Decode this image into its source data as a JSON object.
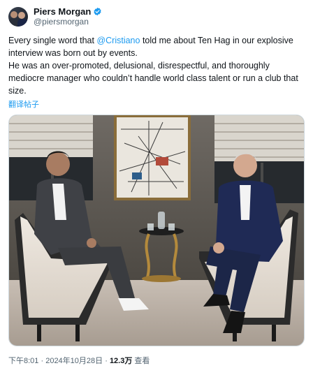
{
  "author": {
    "display_name": "Piers Morgan",
    "handle": "@piersmorgan",
    "verified_color": "#1d9bf0"
  },
  "tweet": {
    "line1_pre": "Every single word that ",
    "mention": "@Cristiano",
    "line1_post": " told me about Ten Hag in our explosive interview was born out by events.",
    "line2": "He was an over-promoted, delusional, disrespectful, and thoroughly mediocre manager who couldn’t handle world class talent or run a club that size.",
    "translate_label": "翻译帖子"
  },
  "media": {
    "icons": [
      "interview-photo"
    ]
  },
  "meta": {
    "time": "下午8:01",
    "sep1": " · ",
    "date": "2024年10月28日",
    "sep2": " · ",
    "views_count": "12.3万",
    "views_label": " 查看"
  },
  "colors": {
    "accent": "#1d9bf0",
    "text": "#0f1419",
    "secondary": "#536471"
  }
}
